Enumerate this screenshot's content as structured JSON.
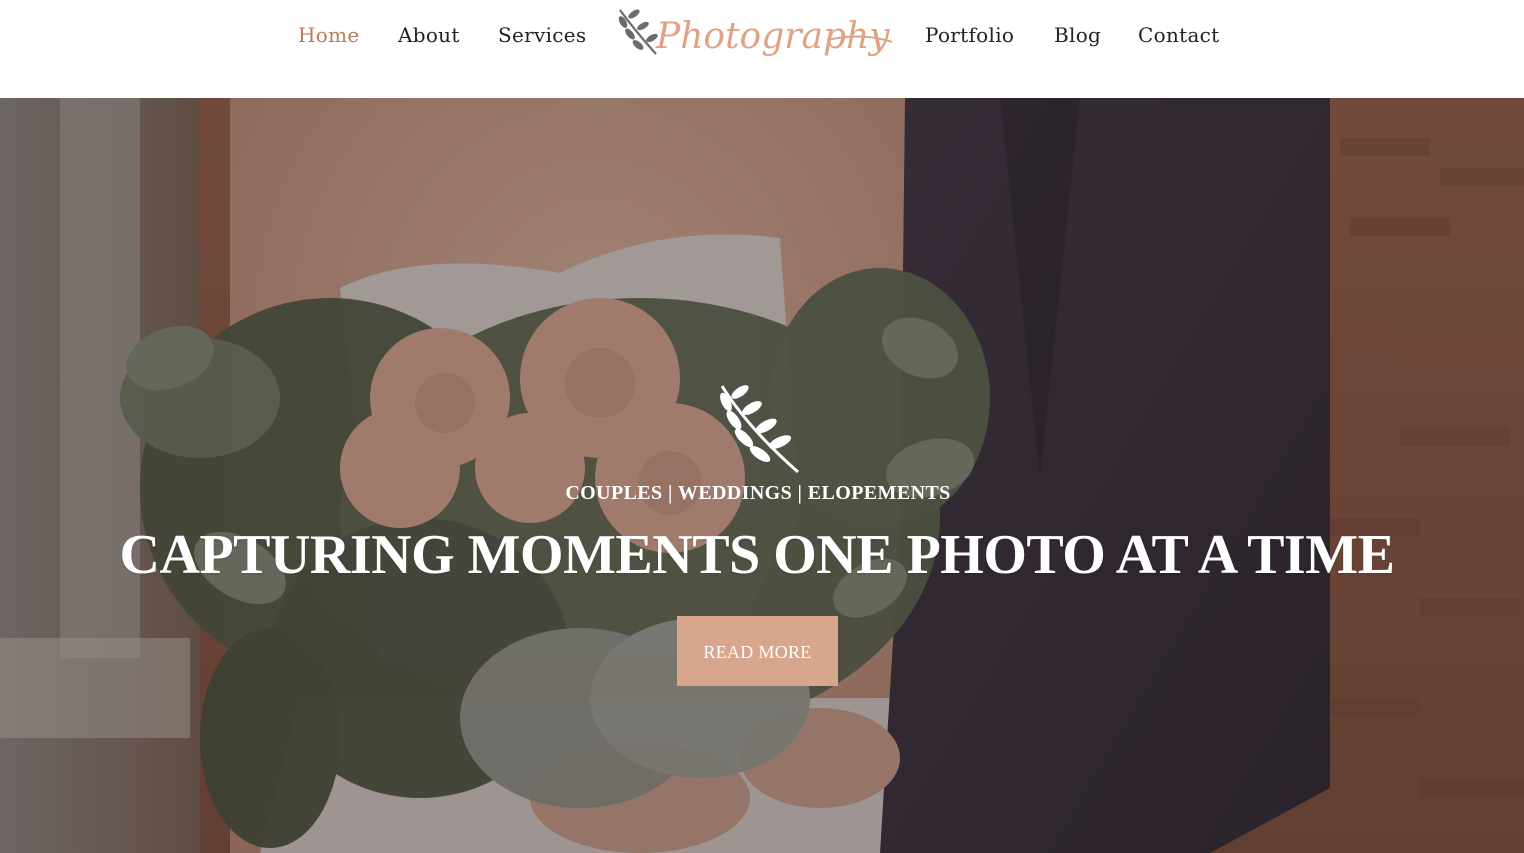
{
  "nav": {
    "items": [
      {
        "label": "Home",
        "active": true
      },
      {
        "label": "About",
        "active": false
      },
      {
        "label": "Services",
        "active": false
      },
      {
        "label": "Portfolio",
        "active": false
      },
      {
        "label": "Blog",
        "active": false
      },
      {
        "label": "Contact",
        "active": false
      }
    ],
    "logo_text": "Photography",
    "logo_icon": "leaf-sprig-icon"
  },
  "hero": {
    "icon": "leaf-sprig-icon",
    "tagline": "COUPLES | WEDDINGS | ELOPEMENTS",
    "title": "CAPTURING MOMENTS ONE PHOTO AT A TIME",
    "button_label": "READ MORE",
    "background_image": "wedding-couple-bouquet-photo"
  },
  "colors": {
    "accent": "#b97a5c",
    "logo": "#e0a285",
    "button": "#d8a58d",
    "nav_text": "#222222"
  }
}
